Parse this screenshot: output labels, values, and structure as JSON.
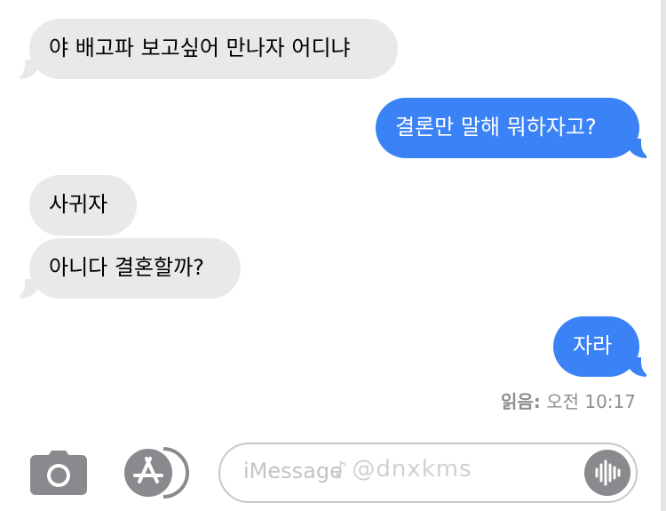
{
  "conversation": {
    "messages": [
      {
        "direction": "incoming",
        "text": "야 배고파 보고싶어 만나자 어디냐"
      },
      {
        "direction": "outgoing",
        "text": "결론만 말해 뭐하자고?"
      },
      {
        "direction": "incoming",
        "text": "사귀자"
      },
      {
        "direction": "incoming",
        "text": "아니다 결혼할까?"
      },
      {
        "direction": "outgoing",
        "text": "자라"
      }
    ],
    "read_receipt": {
      "label": "읽음:",
      "time": "오전 10:17"
    }
  },
  "composer": {
    "placeholder": "iMessage",
    "watermark": "@dnxkms",
    "icons": {
      "camera": "camera-icon",
      "apps": "app-store-icon",
      "voice": "waveform-icon"
    }
  },
  "colors": {
    "incoming_bubble": "#e9e9eb",
    "outgoing_bubble": "#3b82f6",
    "secondary_text": "#8e8e93"
  }
}
